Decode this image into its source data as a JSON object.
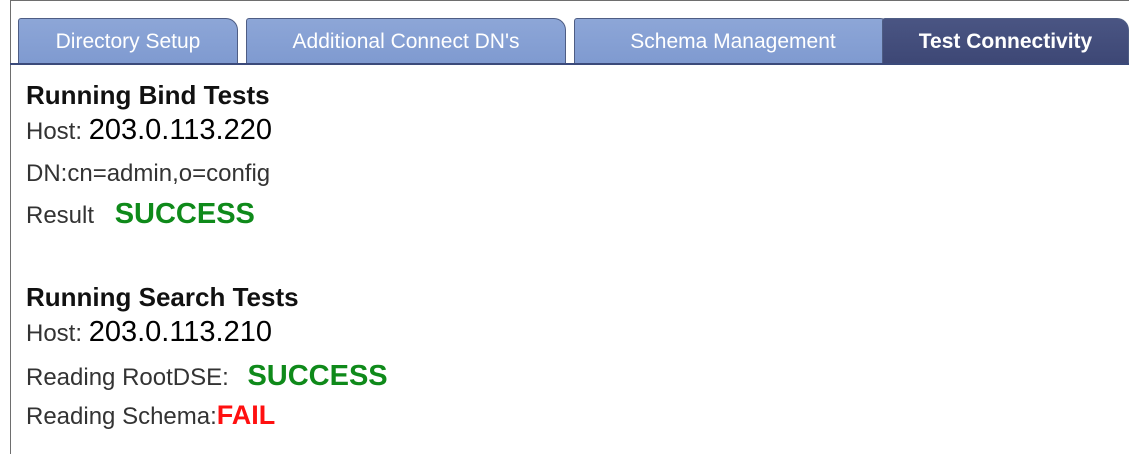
{
  "tabs": [
    {
      "label": "Directory Setup",
      "active": false
    },
    {
      "label": "Additional Connect DN's",
      "active": false
    },
    {
      "label": "Schema Management",
      "active": false
    },
    {
      "label": "Test Connectivity",
      "active": true
    }
  ],
  "bind_tests": {
    "heading": "Running Bind Tests",
    "host_label": "Host:",
    "host_value": "203.0.113.220",
    "dn_label": "DN:",
    "dn_value": "cn=admin,o=config",
    "result_label": "Result",
    "result_value": "SUCCESS"
  },
  "search_tests": {
    "heading": "Running Search Tests",
    "host_label": "Host:",
    "host_value": "203.0.113.210",
    "rootdse_label": "Reading RootDSE:",
    "rootdse_value": "SUCCESS",
    "schema_label": "Reading Schema:",
    "schema_value": "FAIL"
  },
  "colors": {
    "tab_inactive": "#8da6d7",
    "tab_active": "#444f7e",
    "success": "#0f8a1a",
    "fail": "#ff1010"
  }
}
